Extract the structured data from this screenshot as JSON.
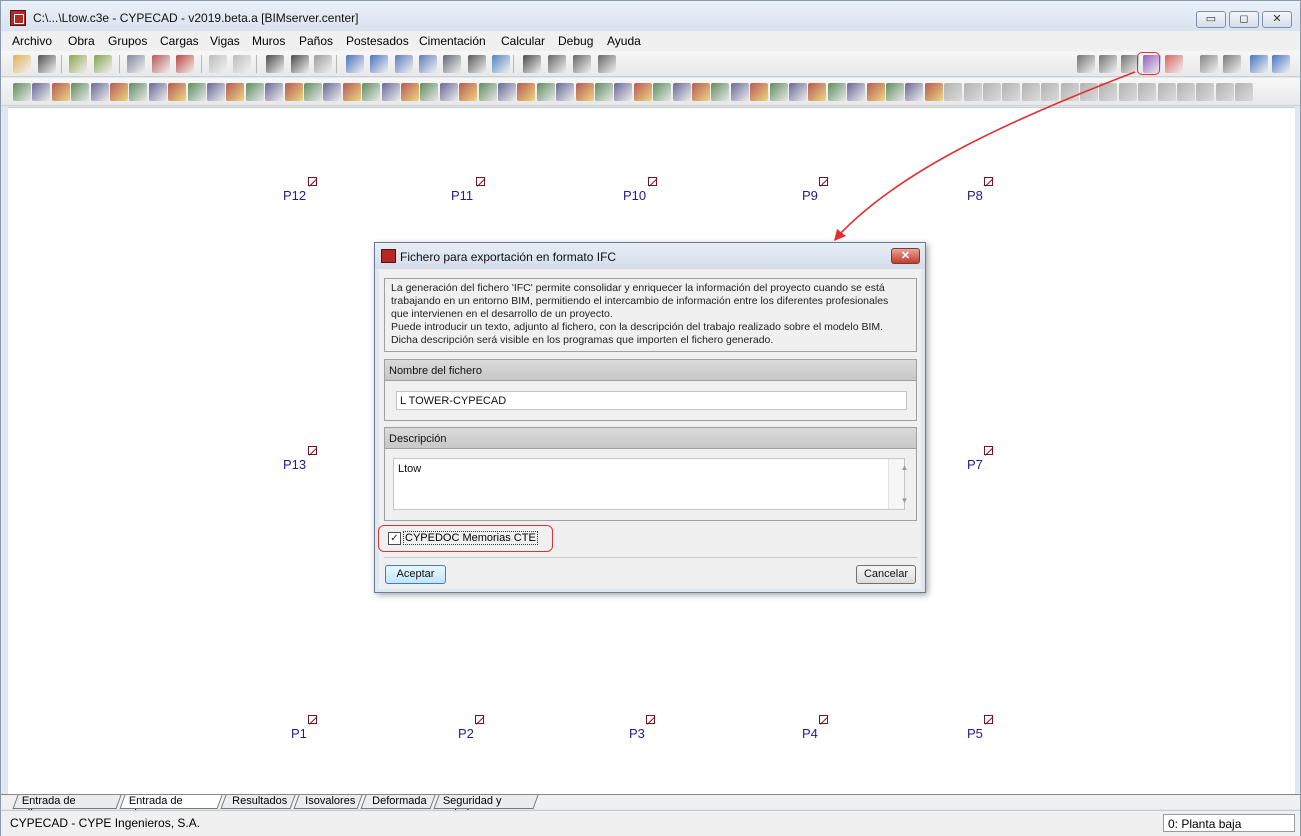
{
  "window": {
    "title": "C:\\...\\Ltow.c3e - CYPECAD - v2019.beta.a [BIMserver.center]",
    "minimize": "▭",
    "maximize": "◻",
    "close": "✕"
  },
  "menu": [
    "Archivo",
    "Obra",
    "Grupos",
    "Cargas",
    "Vigas",
    "Muros",
    "Paños",
    "Postesados",
    "Cimentación",
    "Calcular",
    "Debug",
    "Ayuda"
  ],
  "toolbar_icons": {
    "row1": [
      "open-folder-icon",
      "save-icon",
      "wizard-icon",
      "wizard2-icon",
      "floor-plan-icon",
      "grid-icon",
      "magnet-icon",
      "undo-icon",
      "redo-icon",
      "floor-up-icon",
      "floor-select-icon",
      "floor-down-icon",
      "pan-icon",
      "zoom-all-icon",
      "zoom-in-icon",
      "refresh-icon",
      "zoom-window-icon",
      "hand-icon",
      "window-icon",
      "binoculars-icon",
      "measure-icon",
      "axis-icon",
      "angle-icon",
      "print-icon",
      "3d-view-icon",
      "bim-icon",
      "ifc-export-icon",
      "export-menu-icon",
      "import-icon",
      "compare-icon",
      "help-icon",
      "globe-icon"
    ],
    "row2_count": 64
  },
  "canvas": {
    "pilares_top": [
      "P12",
      "P11",
      "P10",
      "P9",
      "P8"
    ],
    "pilares_mid": [
      "P13",
      "P7"
    ],
    "pilares_bottom": [
      "P1",
      "P2",
      "P3",
      "P4",
      "P5"
    ]
  },
  "dialog": {
    "title": "Fichero para exportación en formato IFC",
    "close": "✕",
    "info_lines": [
      "La generación del fichero 'IFC' permite consolidar y enriquecer la información del proyecto cuando se está",
      "trabajando en un entorno BIM, permitiendo el intercambio de información entre los diferentes profesionales",
      "que intervienen en el desarrollo de un proyecto.",
      "Puede introducir un texto, adjunto al fichero, con la descripción del trabajo realizado sobre el modelo BIM.",
      "Dicha descripción será visible en los programas que importen el fichero generado."
    ],
    "filename_header": "Nombre del fichero",
    "filename_value": "L TOWER-CYPECAD",
    "description_header": "Descripción",
    "description_value": "Ltow",
    "scroll_up": "▲",
    "scroll_down": "▼",
    "checkbox_checked": "✓",
    "checkbox_label": "CYPEDOC Memorias CTE",
    "accept_label": "Aceptar",
    "cancel_label": "Cancelar"
  },
  "tabs": [
    "Entrada de pilares",
    "Entrada de vigas",
    "Resultados",
    "Isovalores",
    "Deformada",
    "Seguridad y salud"
  ],
  "active_tab": "Entrada de vigas",
  "status": {
    "left": "CYPECAD - CYPE Ingenieros, S.A.",
    "right": "0: Planta baja"
  },
  "colors": {
    "annotation": "#e23030",
    "pilar_label": "#1c1c99",
    "pilar_mark": "#7a1020"
  }
}
